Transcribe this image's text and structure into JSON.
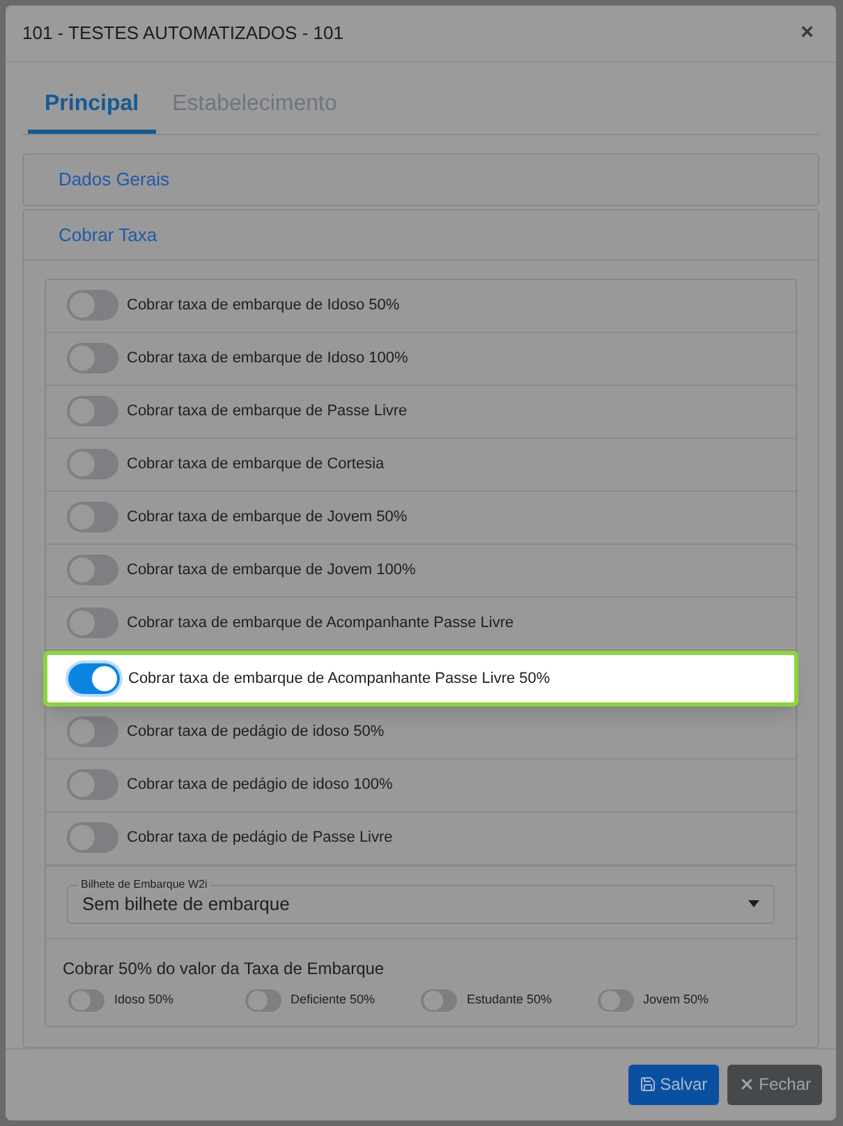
{
  "window": {
    "title": "101 - TESTES AUTOMATIZADOS - 101",
    "close": "×"
  },
  "tabs": [
    {
      "label": "Principal",
      "selected": true
    },
    {
      "label": "Estabelecimento",
      "selected": false
    }
  ],
  "sections": [
    {
      "title": "Dados Gerais",
      "expanded": false
    },
    {
      "title": "Cobrar Taxa",
      "expanded": true
    }
  ],
  "toggles": [
    {
      "label": "Cobrar taxa de embarque de Idoso 50%",
      "on": false,
      "highlighted": false
    },
    {
      "label": "Cobrar taxa de embarque de Idoso 100%",
      "on": false,
      "highlighted": false
    },
    {
      "label": "Cobrar taxa de embarque de Passe Livre",
      "on": false,
      "highlighted": false
    },
    {
      "label": "Cobrar taxa de embarque de Cortesia",
      "on": false,
      "highlighted": false
    },
    {
      "label": "Cobrar taxa de embarque de Jovem 50%",
      "on": false,
      "highlighted": false
    },
    {
      "label": "Cobrar taxa de embarque de Jovem 100%",
      "on": false,
      "highlighted": false
    },
    {
      "label": "Cobrar taxa de embarque de Acompanhante Passe Livre",
      "on": false,
      "highlighted": false
    },
    {
      "label": "Cobrar taxa de embarque de Acompanhante Passe Livre 50%",
      "on": true,
      "highlighted": true
    },
    {
      "label": "Cobrar taxa de pedágio de idoso 50%",
      "on": false,
      "highlighted": false
    },
    {
      "label": "Cobrar taxa de pedágio de idoso 100%",
      "on": false,
      "highlighted": false
    },
    {
      "label": "Cobrar taxa de pedágio de Passe Livre",
      "on": false,
      "highlighted": false
    }
  ],
  "ticket_select": {
    "label": "Bilhete de Embarque W2i",
    "value": "Sem bilhete de embarque"
  },
  "half_fee": {
    "title": "Cobrar 50% do valor da Taxa de Embarque",
    "options": [
      {
        "label": "Idoso 50%",
        "on": false
      },
      {
        "label": "Deficiente 50%",
        "on": false
      },
      {
        "label": "Estudante 50%",
        "on": false
      },
      {
        "label": "Jovem 50%",
        "on": false
      }
    ]
  },
  "buttons": [
    {
      "label": "Salvar",
      "kind": "primary"
    },
    {
      "label": "Fechar",
      "kind": "secondary"
    }
  ]
}
